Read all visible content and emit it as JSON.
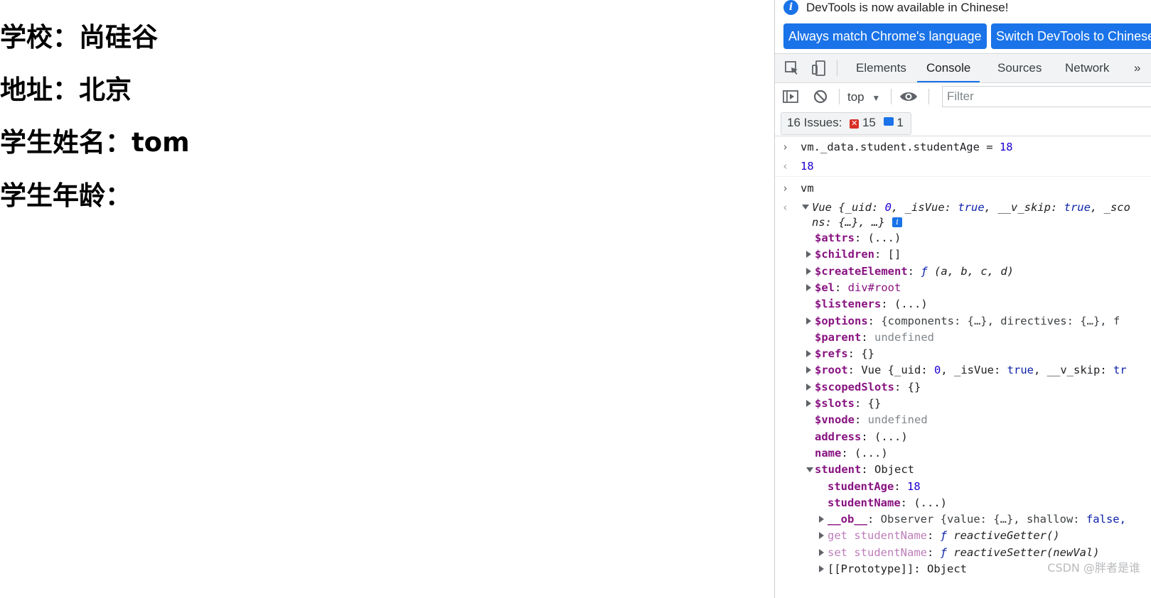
{
  "page": {
    "school": "学校：尚硅谷",
    "address": "地址：北京",
    "student_name": "学生姓名：tom",
    "student_age": "学生年龄："
  },
  "infobar": {
    "message": "DevTools is now available in Chinese!",
    "btn_match": "Always match Chrome's language",
    "btn_switch": "Switch DevTools to Chinese"
  },
  "tabs": {
    "elements": "Elements",
    "console": "Console",
    "sources": "Sources",
    "network": "Network",
    "more": "»"
  },
  "toolbar": {
    "context": "top",
    "filter_placeholder": "Filter"
  },
  "issues": {
    "label": "16 Issues:",
    "errors": "15",
    "info": "1"
  },
  "console": {
    "cmd1": "vm._data.student.studentAge = ",
    "cmd1_val": "18",
    "res1": "18",
    "cmd2": "vm",
    "vue_head": "Vue {_uid: ",
    "vue_uid": "0",
    "vue_isvue_k": ", _isVue: ",
    "vue_isvue": "true",
    "vue_vskip_k": ", __v_skip: ",
    "vue_vskip": "true",
    "vue_tail": ", _sco",
    "vue_line2": "ns: {…}, …}",
    "info_icon": "i",
    "props": [
      {
        "key": "$attrs",
        "sep": ": ",
        "val": "(...)"
      },
      {
        "key": "$children",
        "sep": ": ",
        "val": "[]"
      },
      {
        "key": "$createElement",
        "sep": ": ",
        "fn": "ƒ",
        "val": " (a, b, c, d)"
      },
      {
        "key": "$el",
        "sep": ": ",
        "val": "div#root"
      },
      {
        "key": "$listeners",
        "sep": ": ",
        "val": "(...)"
      },
      {
        "key": "$options",
        "sep": ": ",
        "val": "{components: {…}, directives: {…}, f"
      },
      {
        "key": "$parent",
        "sep": ": ",
        "val": "undefined"
      },
      {
        "key": "$refs",
        "sep": ": ",
        "val": "{}"
      },
      {
        "key": "$root",
        "sep": ": ",
        "val": "Vue {_uid: ",
        "n": "0",
        "v2": ", _isVue: ",
        "b": "true",
        "v3": ", __v_skip: ",
        "b2": "tr"
      },
      {
        "key": "$scopedSlots",
        "sep": ": ",
        "val": "{}"
      },
      {
        "key": "$slots",
        "sep": ": ",
        "val": "{}"
      },
      {
        "key": "$vnode",
        "sep": ": ",
        "val": "undefined"
      },
      {
        "key": "address",
        "sep": ": ",
        "val": "(...)"
      },
      {
        "key": "name",
        "sep": ": ",
        "val": "(...)"
      },
      {
        "key": "student",
        "sep": ": ",
        "val": "Object"
      },
      {
        "key": "studentAge",
        "sep": ": ",
        "val": "18"
      },
      {
        "key": "studentName",
        "sep": ": ",
        "val": "(...)"
      },
      {
        "key": "__ob__",
        "sep": ": ",
        "val": "Observer {value: {…}, shallow: ",
        "b": "false,"
      },
      {
        "key": "get studentName",
        "sep": ": ",
        "fn": "ƒ",
        "val": " reactiveGetter()"
      },
      {
        "key": "set studentName",
        "sep": ": ",
        "fn": "ƒ",
        "val": " reactiveSetter(newVal)"
      },
      {
        "key": "[[Prototype]]",
        "sep": ": ",
        "val": "Object"
      }
    ]
  },
  "watermark": "CSDN @胖者是谁",
  "colors": {
    "accent": "#1a73e8",
    "key": "#881280",
    "number": "#1c00cf"
  },
  "icons": [
    "info-icon",
    "inspect-icon",
    "device-toggle-icon",
    "sidebar-icon",
    "clear-console-icon",
    "dropdown-icon",
    "eye-icon",
    "error-badge-icon",
    "message-badge-icon",
    "expand-arrow-icon"
  ]
}
